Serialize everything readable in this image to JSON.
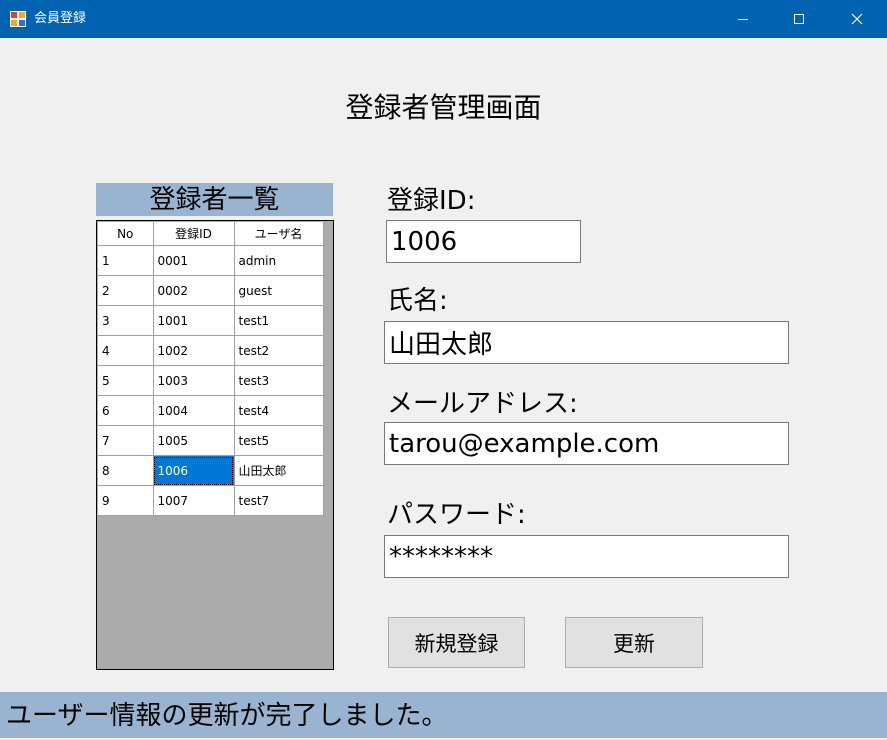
{
  "window": {
    "title": "会員登録",
    "icon": "app-form-icon",
    "controls": [
      "minimize-icon",
      "maximize-icon",
      "close-icon"
    ]
  },
  "page_title": "登録者管理画面",
  "grid": {
    "caption": "登録者一覧",
    "columns": [
      "No",
      "登録ID",
      "ユーザ名"
    ],
    "rows": [
      [
        "1",
        "0001",
        "admin"
      ],
      [
        "2",
        "0002",
        "guest"
      ],
      [
        "3",
        "1001",
        "test1"
      ],
      [
        "4",
        "1002",
        "test2"
      ],
      [
        "5",
        "1003",
        "test3"
      ],
      [
        "6",
        "1004",
        "test4"
      ],
      [
        "7",
        "1005",
        "test5"
      ],
      [
        "8",
        "1006",
        "山田太郎"
      ],
      [
        "9",
        "1007",
        "test7"
      ]
    ],
    "selected_row": 8,
    "selected_column": "登録ID"
  },
  "form": {
    "id_label": "登録ID:",
    "id_value": "1006",
    "name_label": "氏名:",
    "name_value": "山田太郎",
    "email_label": "メールアドレス:",
    "email_value": "tarou@example.com",
    "password_label": "パスワード:",
    "password_value": "********"
  },
  "buttons": {
    "new": "新規登録",
    "update": "更新"
  },
  "status_message": "ユーザー情報の更新が完了しました。",
  "colors": {
    "titlebar": "#0063b1",
    "panel_blue": "#99b4d1",
    "selection": "#0078d7",
    "grid_background": "#ababab"
  }
}
